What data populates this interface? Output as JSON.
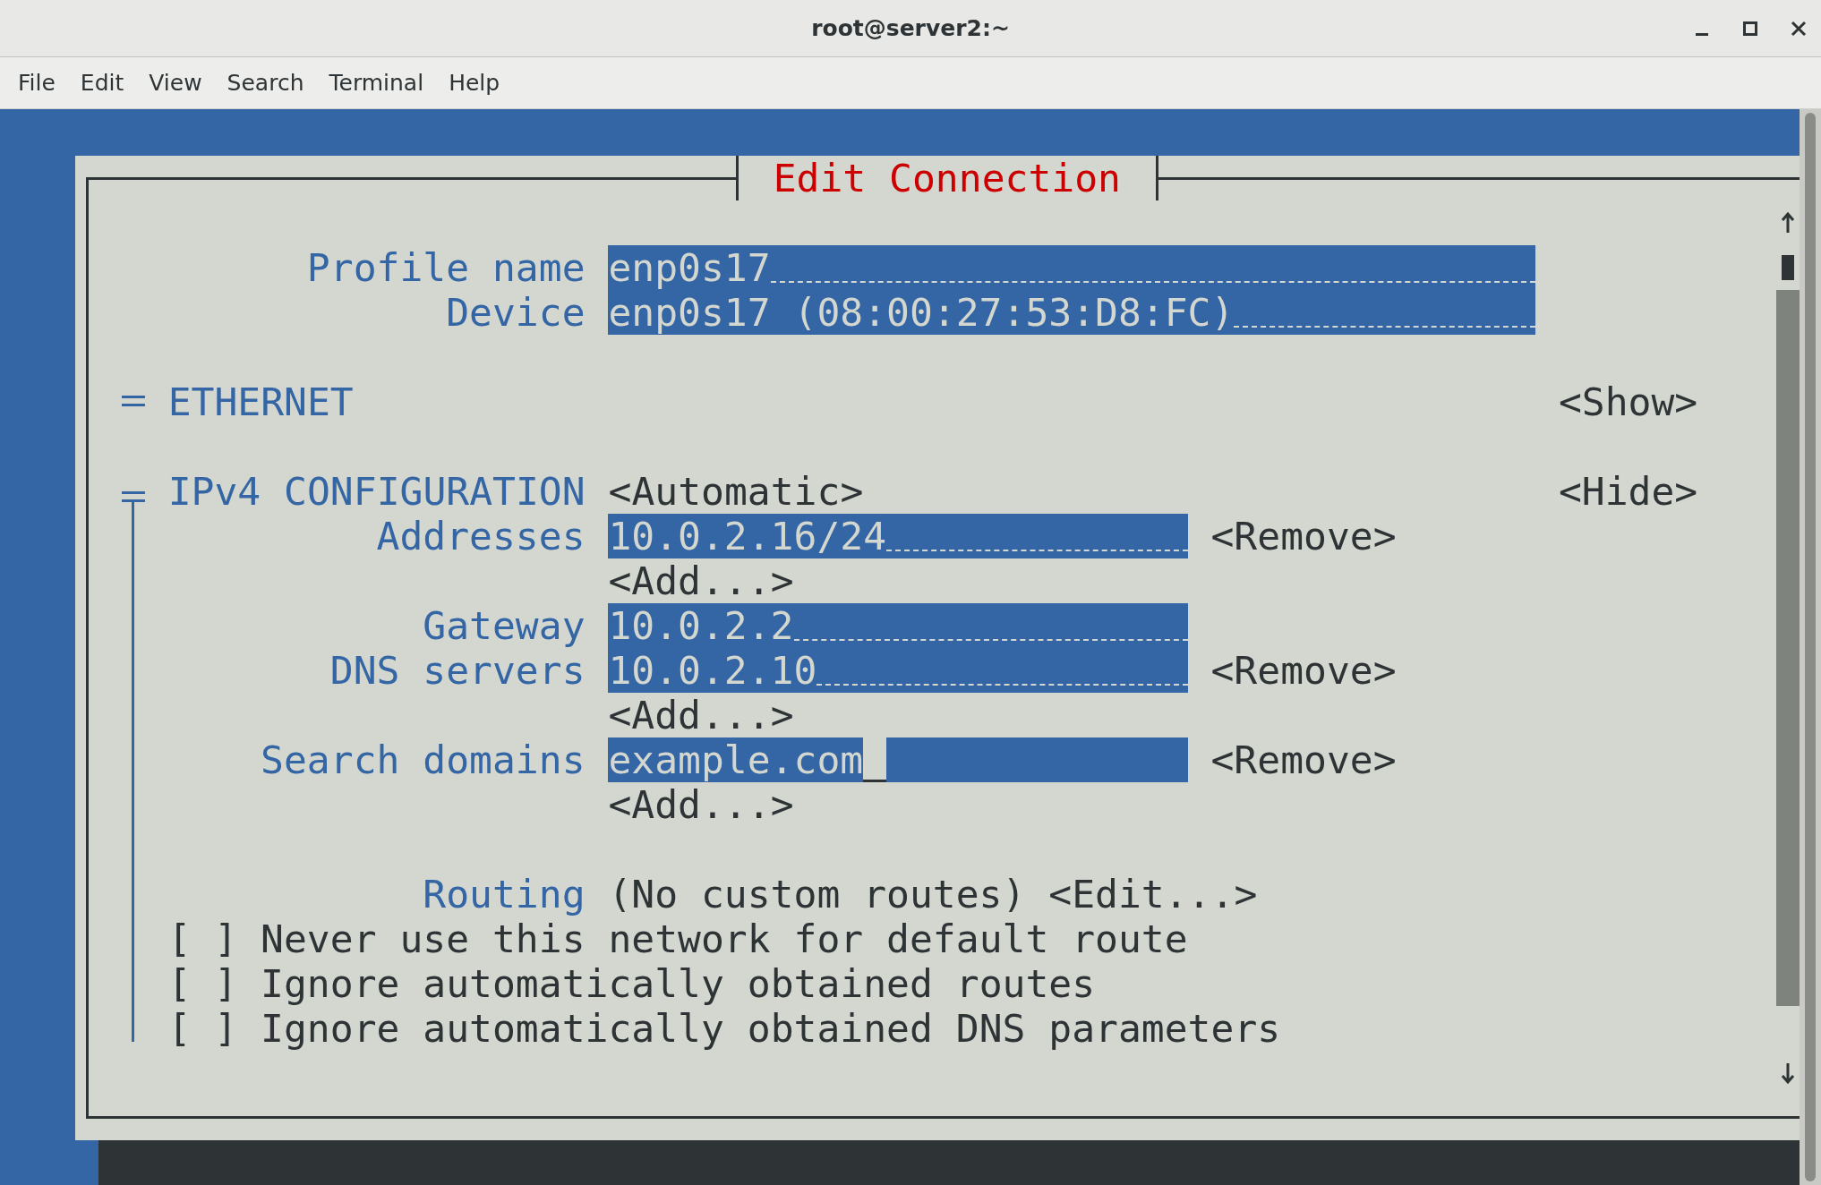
{
  "window": {
    "title": "root@server2:~"
  },
  "menu": [
    "File",
    "Edit",
    "View",
    "Search",
    "Terminal",
    "Help"
  ],
  "dialog": {
    "title": "Edit Connection",
    "fields": [
      {
        "label": "Profile name",
        "value": "enp0s17"
      },
      {
        "label": "Device",
        "value": "enp0s17 (08:00:27:53:D8:FC)"
      }
    ],
    "sections": [
      {
        "title": "ETHERNET",
        "expanded": false,
        "toggle": "<Show>"
      },
      {
        "title": "IPv4 CONFIGURATION",
        "expanded": true,
        "mode": "<Automatic>",
        "toggle": "<Hide>",
        "rows": [
          {
            "kind": "field",
            "label": "Addresses",
            "value": "10.0.2.16/24",
            "focused": false,
            "action": "<Remove>"
          },
          {
            "kind": "add",
            "label": "<Add...>"
          },
          {
            "kind": "field",
            "label": "Gateway",
            "value": "10.0.2.2",
            "focused": false
          },
          {
            "kind": "field",
            "label": "DNS servers",
            "value": "10.0.2.10",
            "focused": false,
            "action": "<Remove>"
          },
          {
            "kind": "add",
            "label": "<Add...>"
          },
          {
            "kind": "field",
            "label": "Search domains",
            "value": "example.com",
            "focused": true,
            "action": "<Remove>"
          },
          {
            "kind": "add",
            "label": "<Add...>"
          },
          {
            "kind": "routing",
            "label": "Routing",
            "value": "(No custom routes)",
            "action": "<Edit...>"
          },
          {
            "kind": "checkbox",
            "box": "[ ]",
            "checked": false,
            "label": "Never use this network for default route"
          },
          {
            "kind": "checkbox",
            "box": "[ ]",
            "checked": false,
            "label": "Ignore automatically obtained routes"
          },
          {
            "kind": "checkbox",
            "box": "[ ]",
            "checked": false,
            "label": "Ignore automatically obtained DNS parameters"
          }
        ]
      }
    ]
  }
}
